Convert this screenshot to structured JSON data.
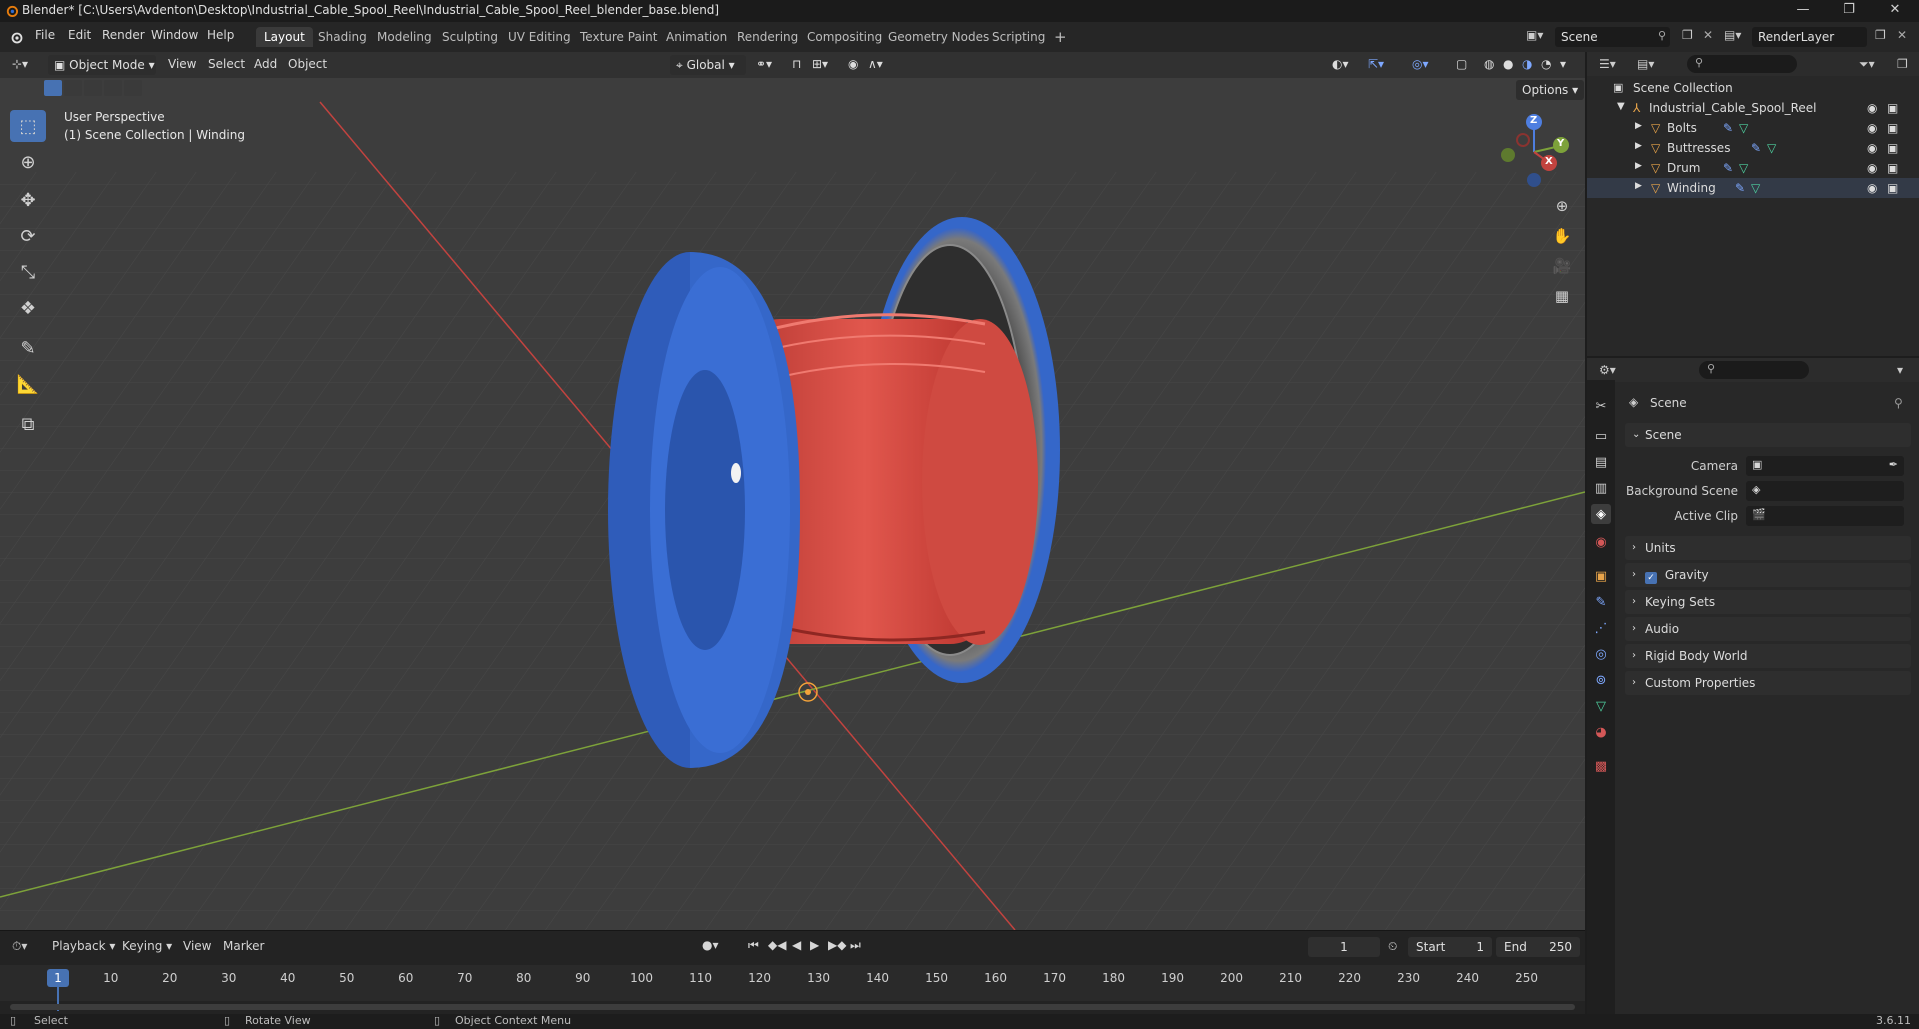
{
  "window": {
    "title": "Blender* [C:\\Users\\Avdenton\\Desktop\\Industrial_Cable_Spool_Reel\\Industrial_Cable_Spool_Reel_blender_base.blend]",
    "minimize": "—",
    "maximize": "❐",
    "close": "✕"
  },
  "menu": {
    "file": "File",
    "edit": "Edit",
    "render": "Render",
    "window": "Window",
    "help": "Help"
  },
  "workspaces": [
    "Layout",
    "Shading",
    "Modeling",
    "Sculpting",
    "UV Editing",
    "Texture Paint",
    "Animation",
    "Rendering",
    "Compositing",
    "Geometry Nodes",
    "Scripting"
  ],
  "workspace_add": "+",
  "scene_selector": {
    "scene": "Scene",
    "view_layer": "RenderLayer"
  },
  "viewport_header": {
    "mode": "Object Mode",
    "view": "View",
    "select": "Select",
    "add": "Add",
    "object": "Object",
    "transform_orientation": "Global",
    "options": "Options"
  },
  "viewport_info": {
    "perspective": "User Perspective",
    "collection": "(1) Scene Collection | Winding"
  },
  "gizmo": {
    "z": "Z",
    "y": "Y",
    "x": "X"
  },
  "outliner": {
    "root": "Scene Collection",
    "collection": "Industrial_Cable_Spool_Reel",
    "objects": [
      "Bolts",
      "Buttresses",
      "Drum",
      "Winding"
    ]
  },
  "properties": {
    "context": "Scene",
    "panel_scene": "Scene",
    "camera_label": "Camera",
    "background_scene_label": "Background Scene",
    "active_clip_label": "Active Clip",
    "units": "Units",
    "gravity": "Gravity",
    "keying_sets": "Keying Sets",
    "audio": "Audio",
    "rigid_body_world": "Rigid Body World",
    "custom_properties": "Custom Properties"
  },
  "timeline": {
    "playback": "Playback",
    "keying": "Keying",
    "view": "View",
    "marker": "Marker",
    "current_frame": "1",
    "start_label": "Start",
    "start": "1",
    "end_label": "End",
    "end": "250",
    "ticks": [
      "10",
      "20",
      "30",
      "40",
      "50",
      "60",
      "70",
      "80",
      "90",
      "100",
      "110",
      "120",
      "130",
      "140",
      "150",
      "160",
      "170",
      "180",
      "190",
      "200",
      "210",
      "220",
      "230",
      "240",
      "250"
    ],
    "playhead": "1"
  },
  "statusbar": {
    "select": "Select",
    "rotate_view": "Rotate View",
    "context_menu": "Object Context Menu",
    "version": "3.6.11"
  },
  "colors": {
    "accent": "#4772b3",
    "spool_blue": "#3567c9",
    "cable_red": "#d9483f",
    "x_axis": "#c2433f",
    "y_axis": "#7da23a"
  }
}
